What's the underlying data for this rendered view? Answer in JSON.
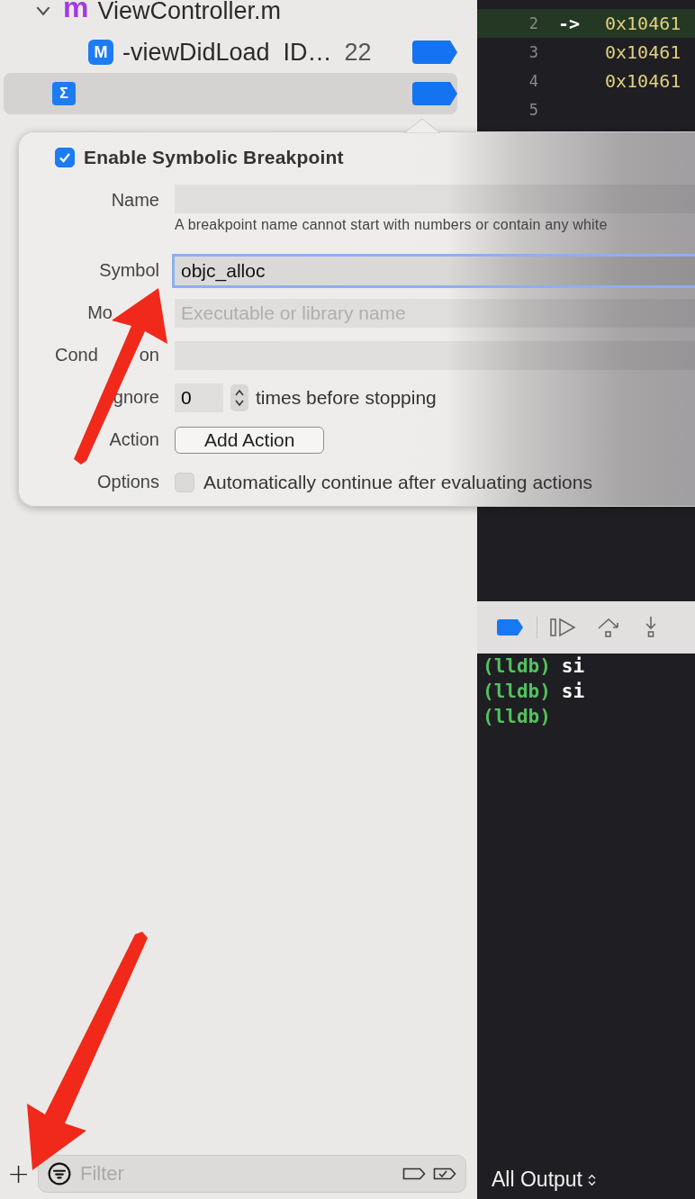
{
  "navigator": {
    "tree": [
      {
        "kind": "file",
        "icon": "m",
        "label": "ViewController.m",
        "expanded": true,
        "children": [
          {
            "kind": "method",
            "icon": "M",
            "label": "-viewDidLoad  ID…",
            "line": "22",
            "selected": false,
            "enabled": true
          },
          {
            "kind": "symbolic",
            "icon": "Σ",
            "selected": true,
            "enabled": true
          }
        ]
      }
    ],
    "add_button": "+",
    "filter": {
      "placeholder": "Filter"
    }
  },
  "code": {
    "lines": [
      {
        "number": "2",
        "marker": "->",
        "text": "0x10461",
        "current": true
      },
      {
        "number": "3",
        "text": "0x10461",
        "current": false
      },
      {
        "number": "4",
        "text": "0x10461",
        "current": false
      },
      {
        "number": "5",
        "current": false
      }
    ]
  },
  "popover": {
    "enable": {
      "label": "Enable Symbolic Breakpoint",
      "checked": true
    },
    "rows": [
      {
        "kind": "text",
        "label": [
          "Name"
        ],
        "hint": "A breakpoint name cannot start with numbers or contain any white"
      },
      {
        "kind": "text",
        "label": [
          "Symbol"
        ],
        "value": "objc_alloc",
        "focused": true
      },
      {
        "kind": "text",
        "label": [
          "Mo",
          {
            "covered": true
          }
        ],
        "placeholder": "Executable or library name"
      },
      {
        "kind": "text",
        "label": [
          "Cond",
          {
            "covered": true
          },
          "on"
        ]
      },
      {
        "kind": "stepper",
        "label": [
          "gnore"
        ],
        "value": "0",
        "suffix": "times before stopping"
      },
      {
        "kind": "button",
        "label": [
          "Action"
        ],
        "button": "Add Action"
      },
      {
        "kind": "checkbox",
        "label": [
          "Options"
        ],
        "text": "Automatically continue after evaluating actions",
        "checked": false
      }
    ]
  },
  "console": {
    "lines": [
      {
        "prompt": "(lldb)",
        "command": "si"
      },
      {
        "prompt": "(lldb)",
        "command": "si"
      },
      {
        "prompt": "(lldb)"
      }
    ],
    "output_selector": "All Output"
  }
}
